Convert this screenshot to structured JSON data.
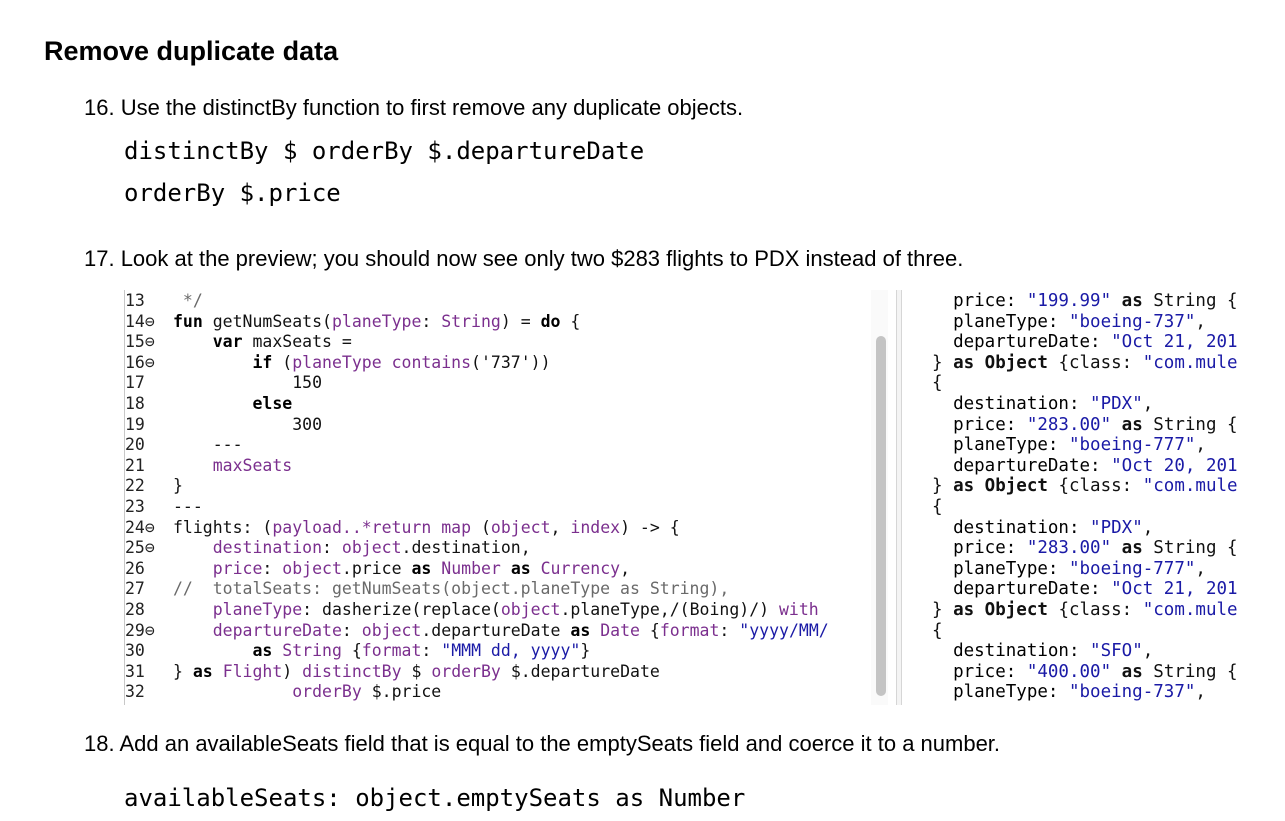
{
  "heading": "Remove duplicate data",
  "steps": [
    {
      "text": "16. Use the distinctBy function to first remove any duplicate objects."
    },
    {
      "text": "17. Look at the preview; you should now see only two $283 flights to PDX instead of three."
    },
    {
      "text": "18. Add an availableSeats field that is equal to the emptySeats field and coerce it to a number."
    }
  ],
  "code_snippets": {
    "distinct_line1": "distinctBy $ orderBy $.departureDate",
    "distinct_line2": "orderBy $.price",
    "available_seats": "availableSeats: object.emptySeats as Number"
  },
  "editor": {
    "gutter": [
      "13",
      "14⊖",
      "15⊖",
      "16⊖",
      "17",
      "18",
      "19",
      "20",
      "21",
      "22",
      "23",
      "24⊖",
      "25⊖",
      "26",
      "27",
      "28",
      "29⊖",
      "30",
      "31",
      "32"
    ],
    "lines": [
      [
        {
          "t": " */",
          "c": "cm"
        }
      ],
      [
        {
          "t": "fun ",
          "c": "kw"
        },
        {
          "t": "getNumSeats(",
          "c": ""
        },
        {
          "t": "planeType",
          "c": "id"
        },
        {
          "t": ": ",
          "c": ""
        },
        {
          "t": "String",
          "c": "id"
        },
        {
          "t": ") = ",
          "c": ""
        },
        {
          "t": "do",
          "c": "kw"
        },
        {
          "t": " {",
          "c": ""
        }
      ],
      [
        {
          "t": "    ",
          "c": ""
        },
        {
          "t": "var ",
          "c": "kw"
        },
        {
          "t": "maxSeats =",
          "c": ""
        }
      ],
      [
        {
          "t": "        ",
          "c": ""
        },
        {
          "t": "if ",
          "c": "kw"
        },
        {
          "t": "(",
          "c": ""
        },
        {
          "t": "planeType contains",
          "c": "id"
        },
        {
          "t": "('737'))",
          "c": ""
        }
      ],
      [
        {
          "t": "            150",
          "c": ""
        }
      ],
      [
        {
          "t": "        ",
          "c": ""
        },
        {
          "t": "else",
          "c": "kw"
        }
      ],
      [
        {
          "t": "            300",
          "c": ""
        }
      ],
      [
        {
          "t": "    ---",
          "c": ""
        }
      ],
      [
        {
          "t": "    ",
          "c": ""
        },
        {
          "t": "maxSeats",
          "c": "id"
        }
      ],
      [
        {
          "t": "}",
          "c": ""
        }
      ],
      [
        {
          "t": "---",
          "c": ""
        }
      ],
      [
        {
          "t": "flights: (",
          "c": ""
        },
        {
          "t": "payload..*return map ",
          "c": "id"
        },
        {
          "t": "(",
          "c": ""
        },
        {
          "t": "object",
          "c": "id"
        },
        {
          "t": ", ",
          "c": ""
        },
        {
          "t": "index",
          "c": "id"
        },
        {
          "t": ") -> {",
          "c": ""
        }
      ],
      [
        {
          "t": "    ",
          "c": ""
        },
        {
          "t": "destination",
          "c": "id"
        },
        {
          "t": ": ",
          "c": ""
        },
        {
          "t": "object",
          "c": "id"
        },
        {
          "t": ".destination,",
          "c": ""
        }
      ],
      [
        {
          "t": "    ",
          "c": ""
        },
        {
          "t": "price",
          "c": "id"
        },
        {
          "t": ": ",
          "c": ""
        },
        {
          "t": "object",
          "c": "id"
        },
        {
          "t": ".price ",
          "c": ""
        },
        {
          "t": "as ",
          "c": "kw"
        },
        {
          "t": "Number ",
          "c": "id"
        },
        {
          "t": "as ",
          "c": "kw"
        },
        {
          "t": "Currency",
          "c": "id"
        },
        {
          "t": ",",
          "c": ""
        }
      ],
      [
        {
          "t": "//  totalSeats: getNumSeats(object.planeType as String),",
          "c": "cm"
        }
      ],
      [
        {
          "t": "    ",
          "c": ""
        },
        {
          "t": "planeType",
          "c": "id"
        },
        {
          "t": ": dasherize(replace(",
          "c": ""
        },
        {
          "t": "object",
          "c": "id"
        },
        {
          "t": ".planeType,/(Boing)/) ",
          "c": ""
        },
        {
          "t": "with",
          "c": "id"
        }
      ],
      [
        {
          "t": "    ",
          "c": ""
        },
        {
          "t": "departureDate",
          "c": "id"
        },
        {
          "t": ": ",
          "c": ""
        },
        {
          "t": "object",
          "c": "id"
        },
        {
          "t": ".departureDate ",
          "c": ""
        },
        {
          "t": "as ",
          "c": "kw"
        },
        {
          "t": "Date ",
          "c": "id"
        },
        {
          "t": "{",
          "c": ""
        },
        {
          "t": "format",
          "c": "id"
        },
        {
          "t": ": ",
          "c": ""
        },
        {
          "t": "\"yyyy/MM/",
          "c": "str"
        }
      ],
      [
        {
          "t": "        ",
          "c": ""
        },
        {
          "t": "as ",
          "c": "kw"
        },
        {
          "t": "String ",
          "c": "id"
        },
        {
          "t": "{",
          "c": ""
        },
        {
          "t": "format",
          "c": "id"
        },
        {
          "t": ": ",
          "c": ""
        },
        {
          "t": "\"MMM dd, yyyy\"",
          "c": "str"
        },
        {
          "t": "}",
          "c": ""
        }
      ],
      [
        {
          "t": "} ",
          "c": ""
        },
        {
          "t": "as ",
          "c": "kw"
        },
        {
          "t": "Flight",
          "c": "id"
        },
        {
          "t": ") ",
          "c": ""
        },
        {
          "t": "distinctBy ",
          "c": "id"
        },
        {
          "t": "$ ",
          "c": ""
        },
        {
          "t": "orderBy ",
          "c": "id"
        },
        {
          "t": "$.departureDate",
          "c": ""
        }
      ],
      [
        {
          "t": "            ",
          "c": ""
        },
        {
          "t": "orderBy ",
          "c": "id"
        },
        {
          "t": "$.price",
          "c": ""
        }
      ]
    ]
  },
  "preview": {
    "lines": [
      [
        {
          "t": "  price: ",
          "c": "pv-key"
        },
        {
          "t": "\"199.99\"",
          "c": "pv-str"
        },
        {
          "t": " as ",
          "c": "pv-kw"
        },
        {
          "t": "String {",
          "c": ""
        }
      ],
      [
        {
          "t": "  planeType: ",
          "c": "pv-key"
        },
        {
          "t": "\"boeing-737\"",
          "c": "pv-str"
        },
        {
          "t": ",",
          "c": ""
        }
      ],
      [
        {
          "t": "  departureDate: ",
          "c": "pv-key"
        },
        {
          "t": "\"Oct 21, 201",
          "c": "pv-str"
        }
      ],
      [
        {
          "t": "} ",
          "c": ""
        },
        {
          "t": "as Object ",
          "c": "pv-kw"
        },
        {
          "t": "{class: ",
          "c": ""
        },
        {
          "t": "\"com.mule",
          "c": "pv-str"
        }
      ],
      [
        {
          "t": "{",
          "c": ""
        }
      ],
      [
        {
          "t": "  destination: ",
          "c": "pv-key"
        },
        {
          "t": "\"PDX\"",
          "c": "pv-str"
        },
        {
          "t": ",",
          "c": ""
        }
      ],
      [
        {
          "t": "  price: ",
          "c": "pv-key"
        },
        {
          "t": "\"283.00\"",
          "c": "pv-str"
        },
        {
          "t": " as ",
          "c": "pv-kw"
        },
        {
          "t": "String {",
          "c": ""
        }
      ],
      [
        {
          "t": "  planeType: ",
          "c": "pv-key"
        },
        {
          "t": "\"boeing-777\"",
          "c": "pv-str"
        },
        {
          "t": ",",
          "c": ""
        }
      ],
      [
        {
          "t": "  departureDate: ",
          "c": "pv-key"
        },
        {
          "t": "\"Oct 20, 201",
          "c": "pv-str"
        }
      ],
      [
        {
          "t": "} ",
          "c": ""
        },
        {
          "t": "as Object ",
          "c": "pv-kw"
        },
        {
          "t": "{class: ",
          "c": ""
        },
        {
          "t": "\"com.mule",
          "c": "pv-str"
        }
      ],
      [
        {
          "t": "{",
          "c": ""
        }
      ],
      [
        {
          "t": "  destination: ",
          "c": "pv-key"
        },
        {
          "t": "\"PDX\"",
          "c": "pv-str"
        },
        {
          "t": ",",
          "c": ""
        }
      ],
      [
        {
          "t": "  price: ",
          "c": "pv-key"
        },
        {
          "t": "\"283.00\"",
          "c": "pv-str"
        },
        {
          "t": " as ",
          "c": "pv-kw"
        },
        {
          "t": "String {",
          "c": ""
        }
      ],
      [
        {
          "t": "  planeType: ",
          "c": "pv-key"
        },
        {
          "t": "\"boeing-777\"",
          "c": "pv-str"
        },
        {
          "t": ",",
          "c": ""
        }
      ],
      [
        {
          "t": "  departureDate: ",
          "c": "pv-key"
        },
        {
          "t": "\"Oct 21, 201",
          "c": "pv-str"
        }
      ],
      [
        {
          "t": "} ",
          "c": ""
        },
        {
          "t": "as Object ",
          "c": "pv-kw"
        },
        {
          "t": "{class: ",
          "c": ""
        },
        {
          "t": "\"com.mule",
          "c": "pv-str"
        }
      ],
      [
        {
          "t": "{",
          "c": ""
        }
      ],
      [
        {
          "t": "  destination: ",
          "c": "pv-key"
        },
        {
          "t": "\"SFO\"",
          "c": "pv-str"
        },
        {
          "t": ",",
          "c": ""
        }
      ],
      [
        {
          "t": "  price: ",
          "c": "pv-key"
        },
        {
          "t": "\"400.00\"",
          "c": "pv-str"
        },
        {
          "t": " as ",
          "c": "pv-kw"
        },
        {
          "t": "String {",
          "c": ""
        }
      ],
      [
        {
          "t": "  planeType: ",
          "c": "pv-key"
        },
        {
          "t": "\"boeing-737\"",
          "c": "pv-str"
        },
        {
          "t": ",",
          "c": ""
        }
      ]
    ]
  }
}
